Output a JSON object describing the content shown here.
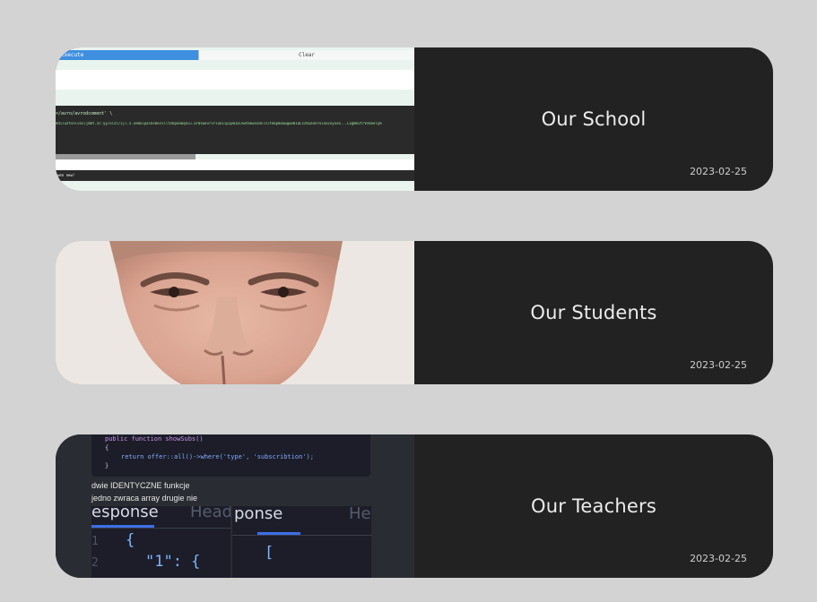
{
  "cards": [
    {
      "title": "Our School",
      "date": "2023-02-25",
      "thumb": {
        "execute_label": "Execute",
        "clear_label": "Clear",
        "line1": "×/avro/avrodcoment' \\",
        "line2": "ddiluztvolvosljmbt.zc-yy/olzi/ijl.z.xe0oipalbsbecvlltzbpoomqalu.ar0swevrvrsuo1ip1p01alewtbewsodvlsltebpmoawgwo01aLzzbuanoroiouvoyoxo...LxgWovtrVvbeolyb",
        "footer": "wen new!"
      }
    },
    {
      "title": "Our Students",
      "date": "2023-02-25"
    },
    {
      "title": "Our Teachers",
      "date": "2023-02-25",
      "thumb": {
        "code_line1": "public function showSubs()",
        "code_line2": "{",
        "code_line3": "return offer::all()->where('type', 'subscribtion');",
        "code_line4": "}",
        "note1": "dwie IDENTYCZNE funkcje",
        "note2": "jedno zwraca array drugie nie",
        "tab1": "esponse",
        "tab1_dim": "Heade",
        "tab2": "ponse",
        "tab2_dim": "He",
        "ln1": "1",
        "ln2": "2",
        "code_a": "{",
        "code_b": "\"1\": {",
        "code_c": "["
      }
    }
  ],
  "colors": {
    "page_bg": "#d3d3d3",
    "card_bg": "#222222",
    "title": "#ececec",
    "date": "#cfcfcf"
  }
}
